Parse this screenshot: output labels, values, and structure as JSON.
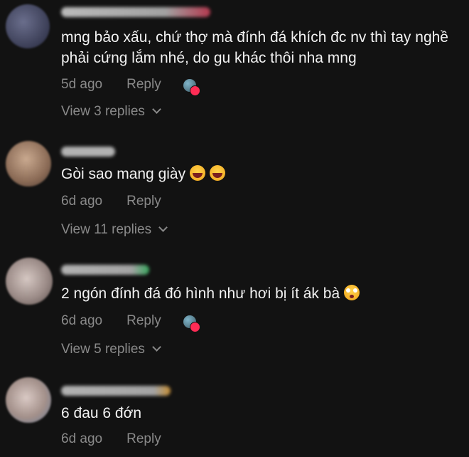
{
  "comments": [
    {
      "text": "mng bảo xấu, chứ thợ mà đính đá khích đc nv thì tay nghề phải cứng lắm nhé, do gu khác thôi nha mng",
      "time": "5d ago",
      "reply": "Reply",
      "view_replies": "View 3 replies",
      "liked_by_creator": true
    },
    {
      "text": "Gòi sao mang giày",
      "emojis": [
        "laughing-emoji",
        "laughing-emoji"
      ],
      "time": "6d ago",
      "reply": "Reply",
      "view_replies": "View 11 replies",
      "liked_by_creator": false
    },
    {
      "text": "2 ngón đính đá đó hình như hơi bị ít ák bà",
      "emojis": [
        "flushed-emoji"
      ],
      "time": "6d ago",
      "reply": "Reply",
      "view_replies": "View 5 replies",
      "liked_by_creator": true
    },
    {
      "text": "6 đau 6 đớn",
      "time": "6d ago",
      "reply": "Reply",
      "liked_by_creator": false
    }
  ],
  "colors": {
    "background": "#121212",
    "text": "#f2f2f2",
    "meta": "#8a8a8a",
    "heart": "#fe2c55"
  }
}
